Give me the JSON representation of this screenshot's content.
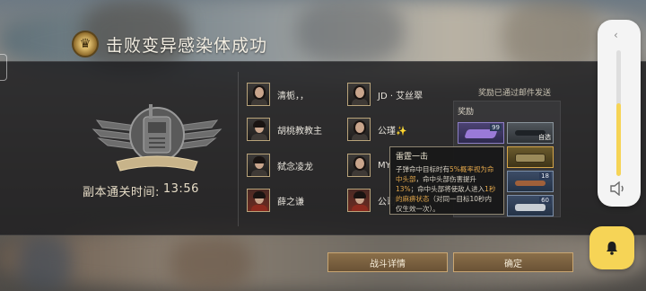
{
  "title": "击败变异感染体成功",
  "clear_time": {
    "label": "副本通关时间:",
    "value": "13:56"
  },
  "players": [
    {
      "name": "清栀，，",
      "avatar": "female"
    },
    {
      "name": "胡桃教教主",
      "avatar": "male"
    },
    {
      "name": "弑念凌龙",
      "avatar": "male"
    },
    {
      "name": "薛之谦",
      "avatar": "male-red"
    },
    {
      "name": "JD · 艾丝翠",
      "avatar": "female"
    },
    {
      "name": "公瑾✨",
      "avatar": "female"
    },
    {
      "name": "MY",
      "avatar": "female"
    },
    {
      "name": "公司",
      "avatar": "male-red"
    }
  ],
  "rewards": {
    "mail_note": "奖励已通过邮件发送",
    "label": "奖励",
    "items": [
      {
        "name": "purple-crystal",
        "count": "99",
        "tag": "",
        "color": "purple"
      },
      {
        "name": "rifle",
        "count": "",
        "tag": "自选",
        "color": "gray"
      },
      {
        "name": "scope-module",
        "count": "",
        "tag": "",
        "color": "gold"
      },
      {
        "name": "ammo",
        "count": "18",
        "tag": "",
        "color": "blue"
      },
      {
        "name": "component",
        "count": "60",
        "tag": "",
        "color": "blue"
      }
    ]
  },
  "tooltip": {
    "title": "雷霆一击",
    "lines": [
      "子弹命中目标时有",
      "5%概率视为",
      "命中头部",
      "，命中头部伤害提升",
      "13%",
      "；命中头部将使敌人进入",
      "1秒的麻痹状态",
      "（对同一目标10秒内仅生效一次）。"
    ]
  },
  "buttons": {
    "detail": "战斗详情",
    "confirm": "确定"
  },
  "volume": {
    "level": 0.58
  },
  "colors": {
    "accent": "#c9a672",
    "highlight": "#e0a54a",
    "widget_yellow": "#f6d456"
  }
}
